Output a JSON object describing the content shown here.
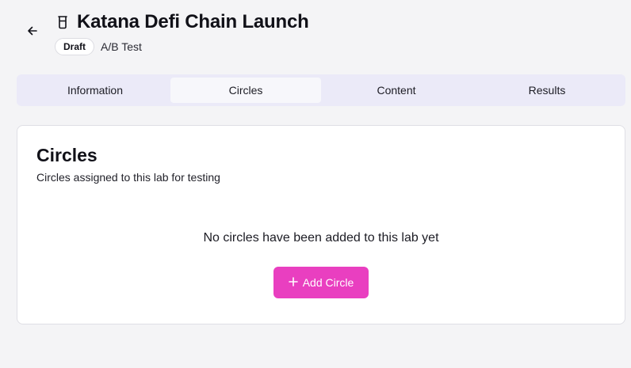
{
  "header": {
    "back_icon": "arrow-left-icon",
    "title_icon": "beaker-icon",
    "title": "Katana Defi Chain Launch",
    "status_badge": "Draft",
    "lab_type": "A/B Test"
  },
  "tabs": [
    {
      "label": "Information",
      "active": false
    },
    {
      "label": "Circles",
      "active": true
    },
    {
      "label": "Content",
      "active": false
    },
    {
      "label": "Results",
      "active": false
    }
  ],
  "circles_card": {
    "title": "Circles",
    "subtitle": "Circles assigned to this lab for testing",
    "empty_message": "No circles have been added to this lab yet",
    "add_button_label": "Add Circle",
    "add_button_icon": "plus-icon"
  },
  "colors": {
    "accent": "#e93fc0",
    "tab_bar_bg": "#ebeaf8",
    "page_bg": "#f4f4f6"
  }
}
